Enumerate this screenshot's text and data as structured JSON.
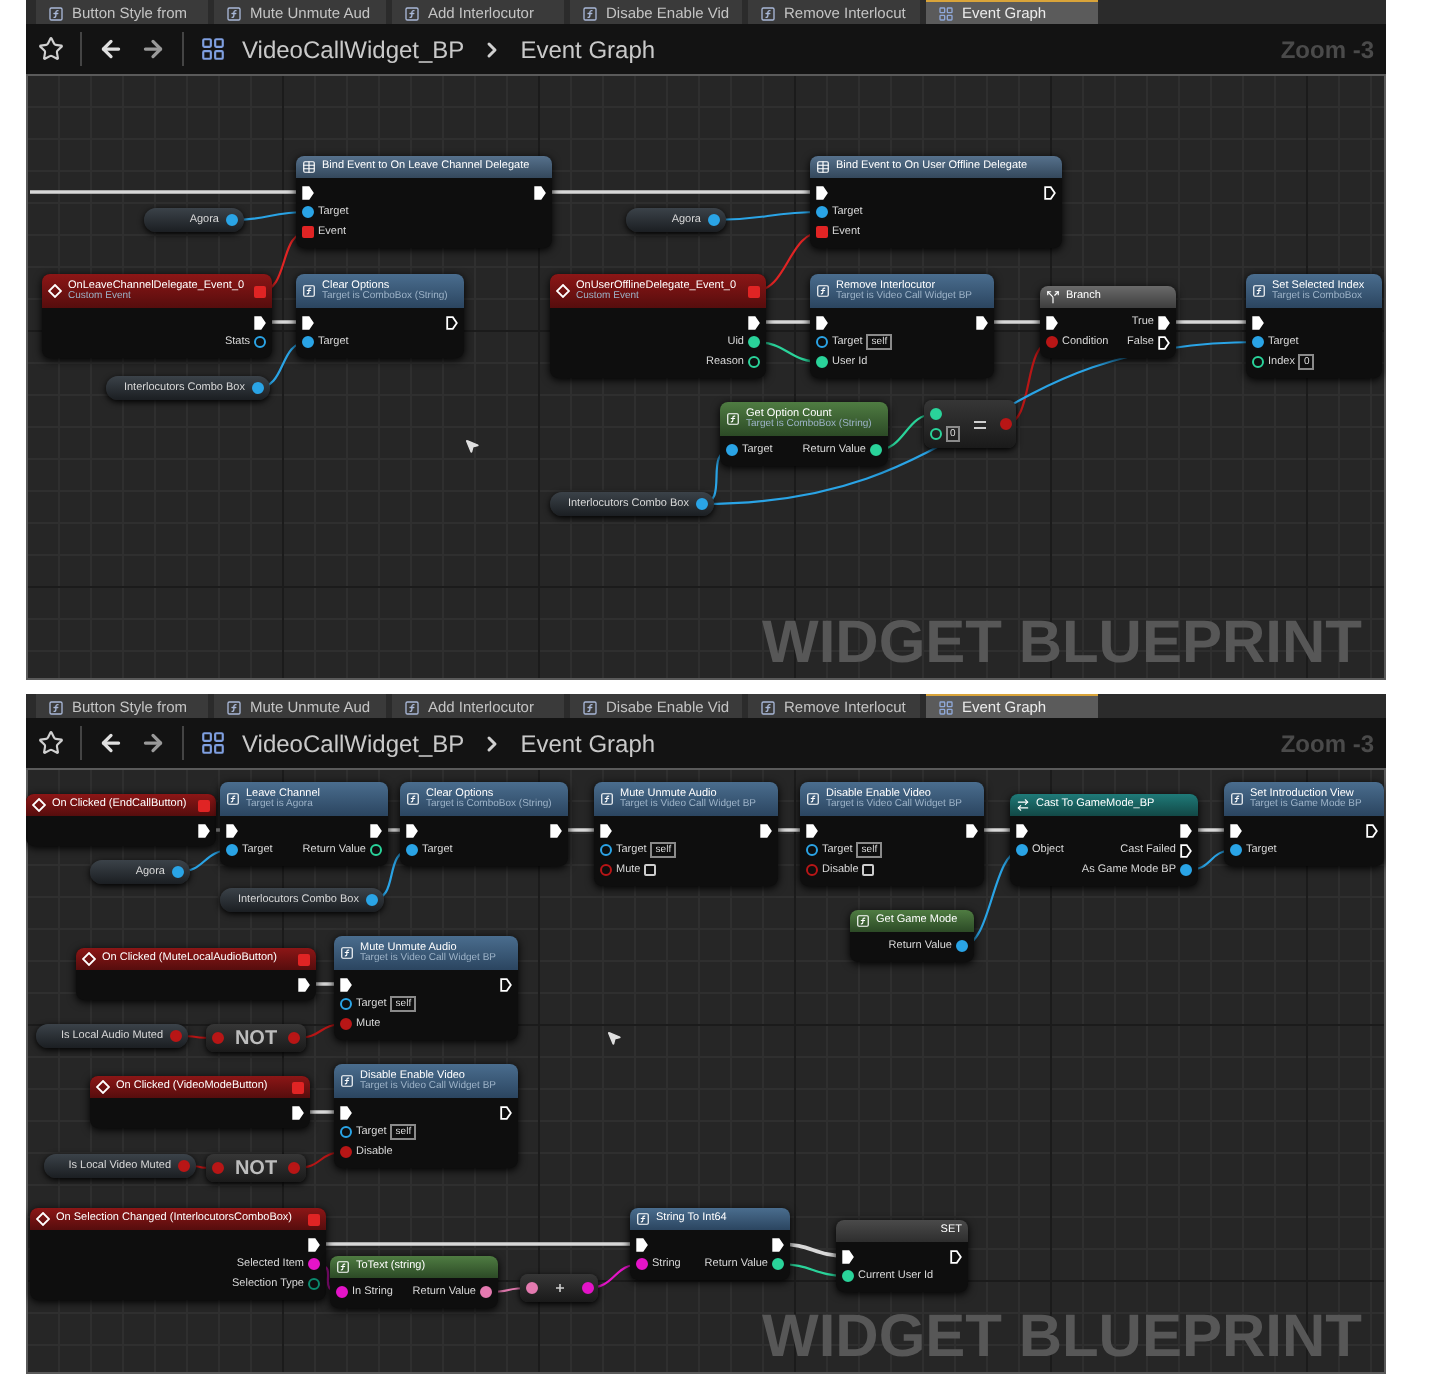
{
  "panels": [
    {
      "tabs": [
        {
          "label": "Button Style from",
          "kind": "function",
          "selected": false
        },
        {
          "label": "Mute Unmute Aud",
          "kind": "function",
          "selected": false
        },
        {
          "label": "Add Interlocutor",
          "kind": "function",
          "selected": false
        },
        {
          "label": "Disabe Enable Vid",
          "kind": "function",
          "selected": false
        },
        {
          "label": "Remove Interlocut",
          "kind": "function",
          "selected": false
        },
        {
          "label": "Event Graph",
          "kind": "graph",
          "selected": true
        }
      ],
      "breadcrumb": {
        "asset": "VideoCallWidget_BP",
        "graph": "Event Graph"
      },
      "zoom_label": "Zoom -3",
      "graph_label": "WIDGET BLUEPRINT",
      "nodes": [
        {
          "kind": "bind",
          "title": "Bind Event to On Leave Channel Delegate",
          "inputs": [
            {
              "kind": "exec",
              "linked": true
            },
            {
              "label": "Target",
              "kind": "object",
              "linked": true
            },
            {
              "label": "Event",
              "kind": "delegate",
              "linked": true
            }
          ],
          "outputs": [
            {
              "kind": "exec",
              "linked": true
            }
          ]
        },
        {
          "kind": "variable",
          "title": "Agora",
          "outputs": [
            {
              "kind": "object",
              "linked": true
            }
          ]
        },
        {
          "kind": "event",
          "title": "OnLeaveChannelDelegate_Event_0",
          "subtitle": "Custom Event",
          "delegate": true,
          "outputs": [
            {
              "kind": "exec",
              "linked": true
            },
            {
              "label": "Stats",
              "kind": "object",
              "linked": false
            }
          ]
        },
        {
          "kind": "function",
          "title": "Clear Options",
          "subtitle": "Target is ComboBox (String)",
          "inputs": [
            {
              "kind": "exec",
              "linked": true
            },
            {
              "label": "Target",
              "kind": "object",
              "linked": true
            }
          ],
          "outputs": [
            {
              "kind": "exec",
              "linked": false
            }
          ]
        },
        {
          "kind": "variable",
          "title": "Interlocutors Combo Box",
          "outputs": [
            {
              "kind": "object",
              "linked": true
            }
          ]
        },
        {
          "kind": "variable",
          "title": "Agora",
          "outputs": [
            {
              "kind": "object",
              "linked": true
            }
          ]
        },
        {
          "kind": "bind",
          "title": "Bind Event to On User Offline Delegate",
          "inputs": [
            {
              "kind": "exec",
              "linked": true
            },
            {
              "label": "Target",
              "kind": "object",
              "linked": true
            },
            {
              "label": "Event",
              "kind": "delegate",
              "linked": true
            }
          ],
          "outputs": [
            {
              "kind": "exec",
              "linked": false
            }
          ]
        },
        {
          "kind": "event",
          "title": "OnUserOfflineDelegate_Event_0",
          "subtitle": "Custom Event",
          "delegate": true,
          "outputs": [
            {
              "kind": "exec",
              "linked": true
            },
            {
              "label": "Uid",
              "kind": "int",
              "linked": true
            },
            {
              "label": "Reason",
              "kind": "int",
              "linked": false
            }
          ]
        },
        {
          "kind": "function",
          "title": "Remove Interlocutor",
          "subtitle": "Target is Video Call Widget BP",
          "inputs": [
            {
              "kind": "exec",
              "linked": true
            },
            {
              "label": "Target",
              "kind": "object",
              "linked": false,
              "value": "self"
            },
            {
              "label": "User Id",
              "kind": "int",
              "linked": true
            }
          ],
          "outputs": [
            {
              "kind": "exec",
              "linked": true
            }
          ]
        },
        {
          "kind": "branch",
          "title": "Branch",
          "inputs": [
            {
              "kind": "exec",
              "linked": true
            },
            {
              "label": "Condition",
              "kind": "bool",
              "linked": true
            }
          ],
          "outputs": [
            {
              "label": "True",
              "kind": "exec",
              "linked": true
            },
            {
              "label": "False",
              "kind": "exec",
              "linked": false
            }
          ]
        },
        {
          "kind": "function",
          "title": "Set Selected Index",
          "subtitle": "Target is ComboBox",
          "inputs": [
            {
              "kind": "exec",
              "linked": true
            },
            {
              "label": "Target",
              "kind": "object",
              "linked": true
            },
            {
              "label": "Index",
              "kind": "int",
              "linked": false,
              "value": "0"
            }
          ]
        },
        {
          "kind": "pure",
          "title": "Get Option Count",
          "subtitle": "Target is ComboBox (String)",
          "inputs": [
            {
              "label": "Target",
              "kind": "object",
              "linked": true
            }
          ],
          "outputs": [
            {
              "label": "Return Value",
              "kind": "int",
              "linked": true
            }
          ]
        },
        {
          "kind": "compare",
          "inputs": [
            {
              "kind": "int",
              "linked": true
            },
            {
              "kind": "int",
              "linked": false,
              "value": "0"
            }
          ],
          "outputs": [
            {
              "kind": "bool",
              "linked": true
            }
          ]
        },
        {
          "kind": "variable",
          "title": "Interlocutors Combo Box",
          "outputs": [
            {
              "kind": "object",
              "linked": true
            }
          ]
        }
      ]
    },
    {
      "tabs": [
        {
          "label": "Button Style from",
          "kind": "function",
          "selected": false
        },
        {
          "label": "Mute Unmute Aud",
          "kind": "function",
          "selected": false
        },
        {
          "label": "Add Interlocutor",
          "kind": "function",
          "selected": false
        },
        {
          "label": "Disabe Enable Vid",
          "kind": "function",
          "selected": false
        },
        {
          "label": "Remove Interlocut",
          "kind": "function",
          "selected": false
        },
        {
          "label": "Event Graph",
          "kind": "graph",
          "selected": true
        }
      ],
      "breadcrumb": {
        "asset": "VideoCallWidget_BP",
        "graph": "Event Graph"
      },
      "zoom_label": "Zoom -3",
      "graph_label": "WIDGET BLUEPRINT",
      "nodes": [
        {
          "kind": "event",
          "title": "On Clicked (EndCallButton)",
          "delegate": true,
          "outputs": [
            {
              "kind": "exec",
              "linked": true
            }
          ]
        },
        {
          "kind": "function",
          "title": "Leave Channel",
          "subtitle": "Target is Agora",
          "inputs": [
            {
              "kind": "exec",
              "linked": true
            },
            {
              "label": "Target",
              "kind": "object",
              "linked": true
            }
          ],
          "outputs": [
            {
              "kind": "exec",
              "linked": true
            },
            {
              "label": "Return Value",
              "kind": "int",
              "linked": false
            }
          ]
        },
        {
          "kind": "function",
          "title": "Clear Options",
          "subtitle": "Target is ComboBox (String)",
          "inputs": [
            {
              "kind": "exec",
              "linked": true
            },
            {
              "label": "Target",
              "kind": "object",
              "linked": true
            }
          ],
          "outputs": [
            {
              "kind": "exec",
              "linked": true
            }
          ]
        },
        {
          "kind": "function",
          "title": "Mute Unmute Audio",
          "subtitle": "Target is Video Call Widget BP",
          "inputs": [
            {
              "kind": "exec",
              "linked": true
            },
            {
              "label": "Target",
              "kind": "object",
              "linked": false,
              "value": "self"
            },
            {
              "label": "Mute",
              "kind": "bool",
              "linked": false,
              "checked": false
            }
          ],
          "outputs": [
            {
              "kind": "exec",
              "linked": true
            }
          ]
        },
        {
          "kind": "function",
          "title": "Disable Enable Video",
          "subtitle": "Target is Video Call Widget BP",
          "inputs": [
            {
              "kind": "exec",
              "linked": true
            },
            {
              "label": "Target",
              "kind": "object",
              "linked": false,
              "value": "self"
            },
            {
              "label": "Disable",
              "kind": "bool",
              "linked": false,
              "checked": false
            }
          ],
          "outputs": [
            {
              "kind": "exec",
              "linked": true
            }
          ]
        },
        {
          "kind": "cast",
          "title": "Cast To GameMode_BP",
          "inputs": [
            {
              "kind": "exec",
              "linked": true
            },
            {
              "label": "Object",
              "kind": "object",
              "linked": true
            }
          ],
          "outputs": [
            {
              "kind": "exec",
              "linked": true
            },
            {
              "label": "Cast Failed",
              "kind": "exec",
              "linked": false
            },
            {
              "label": "As Game Mode BP",
              "kind": "object",
              "linked": true
            }
          ]
        },
        {
          "kind": "function",
          "title": "Set Introduction View",
          "subtitle": "Target is Game Mode BP",
          "inputs": [
            {
              "kind": "exec",
              "linked": true
            },
            {
              "label": "Target",
              "kind": "object",
              "linked": true
            }
          ],
          "outputs": [
            {
              "kind": "exec",
              "linked": false
            }
          ]
        },
        {
          "kind": "variable",
          "title": "Agora",
          "outputs": [
            {
              "kind": "object",
              "linked": true
            }
          ]
        },
        {
          "kind": "variable",
          "title": "Interlocutors Combo Box",
          "outputs": [
            {
              "kind": "object",
              "linked": true
            }
          ]
        },
        {
          "kind": "pure",
          "title": "Get Game Mode",
          "outputs": [
            {
              "label": "Return Value",
              "kind": "object",
              "linked": true
            }
          ]
        },
        {
          "kind": "event",
          "title": "On Clicked (MuteLocalAudioButton)",
          "delegate": true,
          "outputs": [
            {
              "kind": "exec",
              "linked": true
            }
          ]
        },
        {
          "kind": "function",
          "title": "Mute Unmute Audio",
          "subtitle": "Target is Video Call Widget BP",
          "inputs": [
            {
              "kind": "exec",
              "linked": true
            },
            {
              "label": "Target",
              "kind": "object",
              "linked": false,
              "value": "self"
            },
            {
              "label": "Mute",
              "kind": "bool",
              "linked": true
            }
          ],
          "outputs": [
            {
              "kind": "exec",
              "linked": false
            }
          ]
        },
        {
          "kind": "variable",
          "title": "Is Local Audio Muted",
          "outputs": [
            {
              "kind": "bool",
              "linked": true
            }
          ]
        },
        {
          "kind": "operator",
          "title": "NOT",
          "inputs": [
            {
              "kind": "bool",
              "linked": true
            }
          ],
          "outputs": [
            {
              "kind": "bool",
              "linked": true
            }
          ]
        },
        {
          "kind": "event",
          "title": "On Clicked (VideoModeButton)",
          "delegate": true,
          "outputs": [
            {
              "kind": "exec",
              "linked": true
            }
          ]
        },
        {
          "kind": "function",
          "title": "Disable Enable Video",
          "subtitle": "Target is Video Call Widget BP",
          "inputs": [
            {
              "kind": "exec",
              "linked": true
            },
            {
              "label": "Target",
              "kind": "object",
              "linked": false,
              "value": "self"
            },
            {
              "label": "Disable",
              "kind": "bool",
              "linked": true
            }
          ],
          "outputs": [
            {
              "kind": "exec",
              "linked": false
            }
          ]
        },
        {
          "kind": "variable",
          "title": "Is Local Video Muted",
          "outputs": [
            {
              "kind": "bool",
              "linked": true
            }
          ]
        },
        {
          "kind": "operator",
          "title": "NOT",
          "inputs": [
            {
              "kind": "bool",
              "linked": true
            }
          ],
          "outputs": [
            {
              "kind": "bool",
              "linked": true
            }
          ]
        },
        {
          "kind": "event",
          "title": "On Selection Changed (InterlocutorsComboBox)",
          "delegate": true,
          "outputs": [
            {
              "kind": "exec",
              "linked": true
            },
            {
              "label": "Selected Item",
              "kind": "string",
              "linked": true
            },
            {
              "label": "Selection Type",
              "kind": "byte",
              "linked": false
            }
          ]
        },
        {
          "kind": "pure",
          "title": "ToText (string)",
          "inputs": [
            {
              "label": "In String",
              "kind": "string",
              "linked": true
            }
          ],
          "outputs": [
            {
              "label": "Return Value",
              "kind": "text",
              "linked": true
            }
          ]
        },
        {
          "kind": "append",
          "inputs": [
            {
              "kind": "text",
              "linked": true
            }
          ],
          "outputs": [
            {
              "kind": "string",
              "linked": true
            }
          ]
        },
        {
          "kind": "function",
          "title": "String To Int64",
          "inputs": [
            {
              "kind": "exec",
              "linked": true
            },
            {
              "label": "String",
              "kind": "string",
              "linked": true
            }
          ],
          "outputs": [
            {
              "kind": "exec",
              "linked": true
            },
            {
              "label": "Return Value",
              "kind": "int",
              "linked": true
            }
          ]
        },
        {
          "kind": "set",
          "title": "SET",
          "inputs": [
            {
              "kind": "exec",
              "linked": true
            },
            {
              "label": "Current User Id",
              "kind": "int",
              "linked": true
            }
          ],
          "outputs": [
            {
              "kind": "exec",
              "linked": false
            }
          ]
        }
      ]
    }
  ]
}
